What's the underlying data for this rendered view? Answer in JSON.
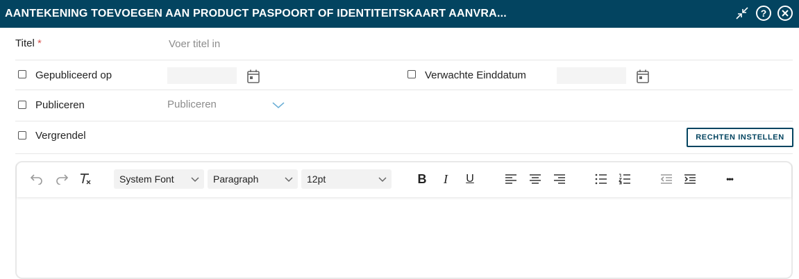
{
  "window": {
    "title": "AANTEKENING TOEVOEGEN AAN PRODUCT PASPOORT OF IDENTITEITSKAART AANVRA...",
    "help_glyph": "?",
    "icons": [
      "minimize-icon",
      "help-icon",
      "close-icon"
    ]
  },
  "form": {
    "title_label": "Titel",
    "required_mark": "*",
    "title_placeholder": "Voer titel in",
    "published_label": "Gepubliceerd op",
    "expected_end_label": "Verwachte Einddatum",
    "publish_label": "Publiceren",
    "publish_placeholder": "Publiceren",
    "lock_label": "Vergrendel",
    "rights_button": "RECHTEN INSTELLEN"
  },
  "editor": {
    "font_family": "System Font",
    "block_format": "Paragraph",
    "font_size": "12pt",
    "bold_glyph": "B",
    "italic_glyph": "I",
    "underline_glyph": "U",
    "more_glyph": "•••"
  },
  "colors": {
    "header": "#034460",
    "required": "#d9534f",
    "placeholder": "#8c8c8c"
  }
}
